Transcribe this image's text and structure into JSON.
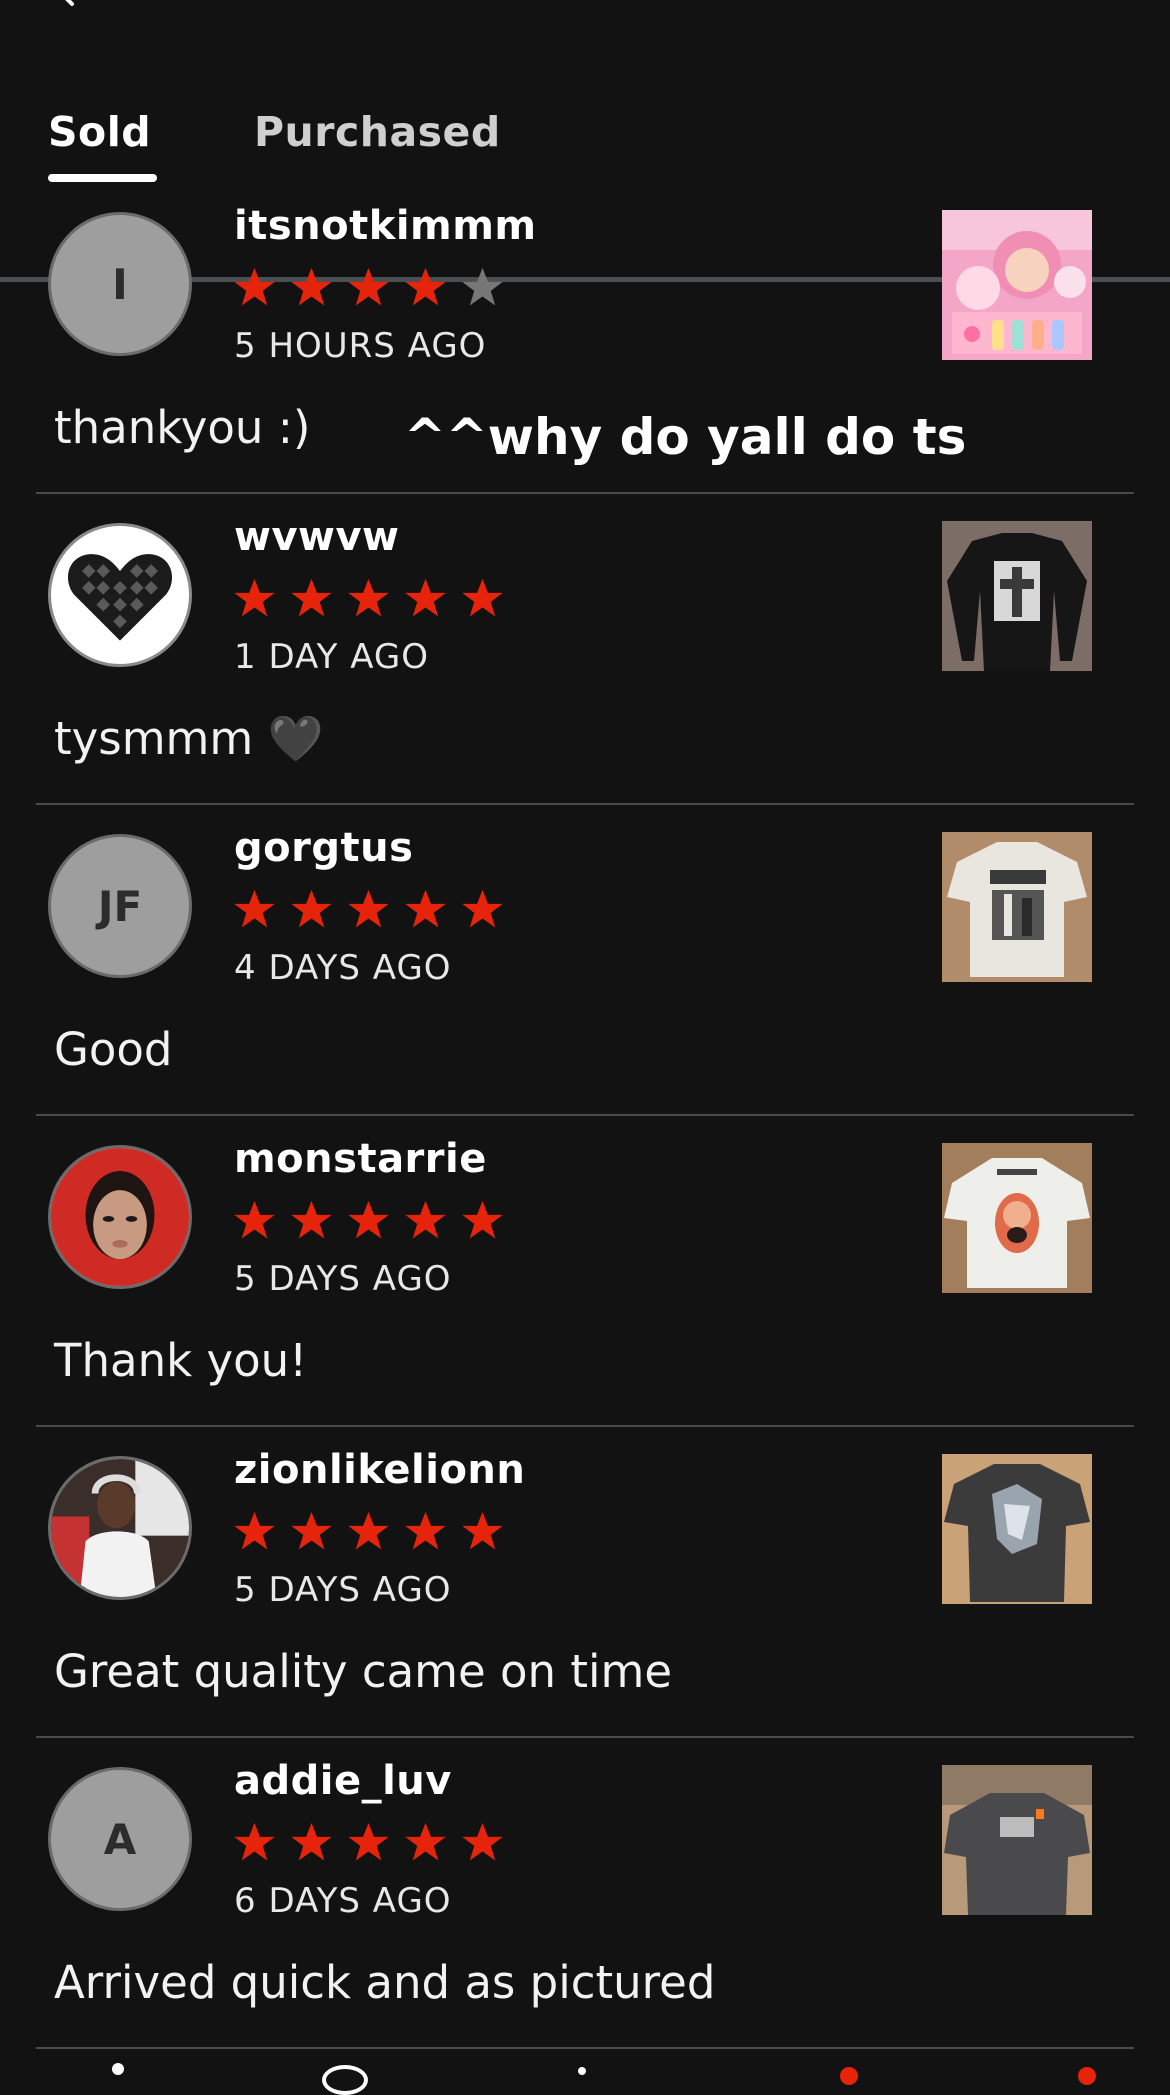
{
  "tabs": {
    "sold_label": "Sold",
    "purchased_label": "Purchased",
    "active": "Sold"
  },
  "colors": {
    "star_filled": "#e6230b",
    "star_empty": "#777777",
    "background": "#121212"
  },
  "reviews": [
    {
      "username": "itsnotkimmm",
      "avatar_initials": "I",
      "rating": 4,
      "time": "5 HOURS AGO",
      "comment": "thankyou :)",
      "overlay_text": "^^why do yall do ts"
    },
    {
      "username": "wvwvw",
      "avatar_initials": "",
      "rating": 5,
      "time": "1 DAY AGO",
      "comment": "tysmmm 🖤"
    },
    {
      "username": "gorgtus",
      "avatar_initials": "JF",
      "rating": 5,
      "time": "4 DAYS AGO",
      "comment": "Good"
    },
    {
      "username": "monstarrie",
      "avatar_initials": "",
      "rating": 5,
      "time": "5 DAYS AGO",
      "comment": "Thank you!"
    },
    {
      "username": "zionlikelionn",
      "avatar_initials": "",
      "rating": 5,
      "time": "5 DAYS AGO",
      "comment": "Great quality came on time"
    },
    {
      "username": "addie_luv",
      "avatar_initials": "A",
      "rating": 5,
      "time": "6 DAYS AGO",
      "comment": "Arrived quick and as pictured"
    }
  ]
}
